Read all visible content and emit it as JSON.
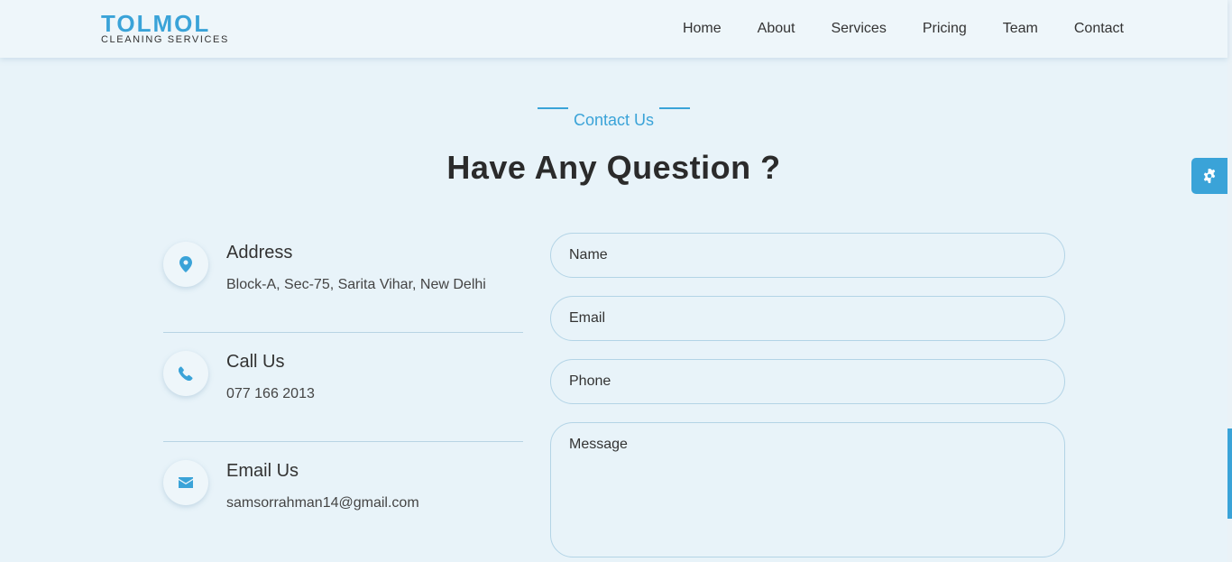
{
  "brand": {
    "name": "TOLMOL",
    "tagline": "CLEANING SERVICES",
    "accent": "#3aa3d8"
  },
  "nav": {
    "items": [
      "Home",
      "About",
      "Services",
      "Pricing",
      "Team",
      "Contact"
    ]
  },
  "section": {
    "subtitle": "Contact Us",
    "title": "Have Any Question ?"
  },
  "contact": {
    "address": {
      "heading": "Address",
      "value": "Block-A, Sec-75, Sarita Vihar, New Delhi",
      "icon": "map-marker-icon"
    },
    "phone": {
      "heading": "Call Us",
      "value": "077 166 2013",
      "icon": "phone-icon"
    },
    "email": {
      "heading": "Email Us",
      "value": "samsorrahman14@gmail.com",
      "icon": "envelope-icon"
    }
  },
  "form": {
    "name_placeholder": "Name",
    "email_placeholder": "Email",
    "phone_placeholder": "Phone",
    "message_placeholder": "Message"
  },
  "settings": {
    "icon": "gear-icon"
  }
}
